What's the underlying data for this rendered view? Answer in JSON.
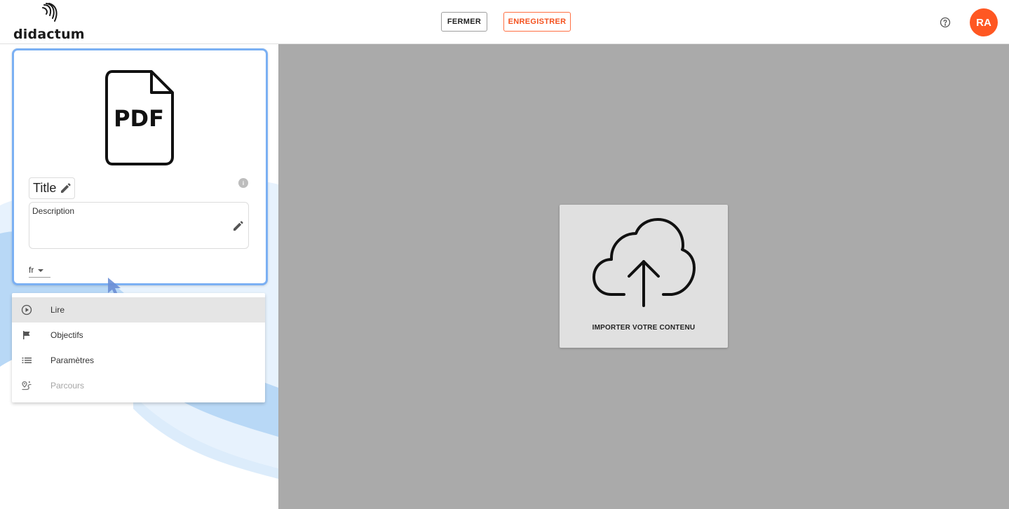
{
  "brand": {
    "name": "didactum"
  },
  "toolbar": {
    "close_label": "FERMER",
    "save_label": "ENREGISTRER"
  },
  "user": {
    "initials": "RA",
    "avatar_color": "#ff5722"
  },
  "card": {
    "file_type": "PDF",
    "title": "Title",
    "description_label": "Description",
    "language": "fr"
  },
  "menu": {
    "items": [
      {
        "label": "Lire",
        "icon": "play-circle-icon"
      },
      {
        "label": "Objectifs",
        "icon": "flag-icon"
      },
      {
        "label": "Paramètres",
        "icon": "list-icon"
      },
      {
        "label": "Parcours",
        "icon": "route-icon"
      }
    ]
  },
  "upload": {
    "label": "IMPORTER VOTRE CONTENU",
    "icon": "cloud-upload-icon"
  },
  "colors": {
    "accent_orange": "#f4511e",
    "card_highlight": "#7bb0f3",
    "main_background": "#aaaaaa",
    "upload_card": "#e0e0e0"
  }
}
